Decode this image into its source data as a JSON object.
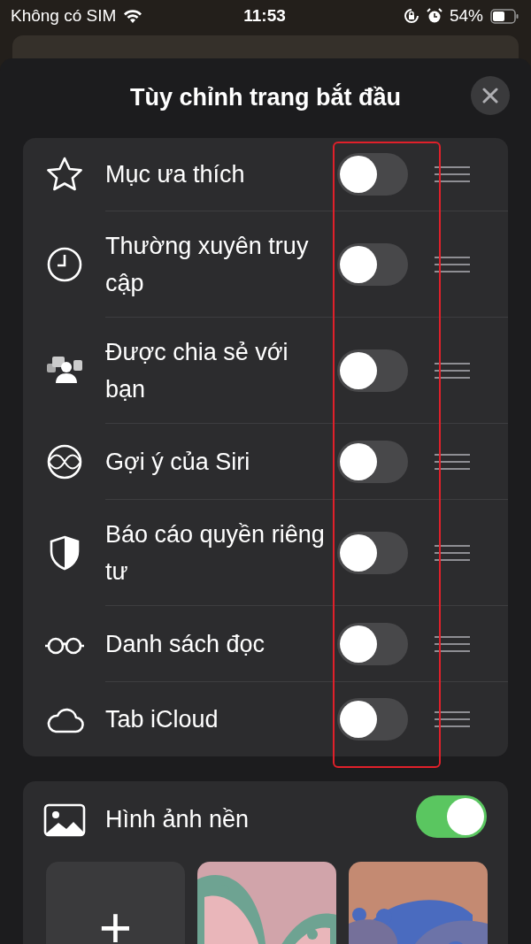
{
  "status_bar": {
    "carrier": "Không có SIM",
    "time": "11:53",
    "battery": "54%"
  },
  "title": "Tùy chỉnh trang bắt đầu",
  "sections": [
    {
      "label": "Mục ưa thích",
      "on": false
    },
    {
      "label": "Thường xuyên truy cập",
      "on": false
    },
    {
      "label": "Được chia sẻ với bạn",
      "on": false
    },
    {
      "label": "Gợi ý của Siri",
      "on": false
    },
    {
      "label": "Báo cáo quyền riêng tư",
      "on": false
    },
    {
      "label": "Danh sách đọc",
      "on": false
    },
    {
      "label": "Tab iCloud",
      "on": false
    }
  ],
  "wallpaper": {
    "label": "Hình ảnh nền",
    "on": true,
    "thumbnails": [
      {
        "kind": "add",
        "label": "+"
      },
      {
        "kind": "picture"
      },
      {
        "kind": "picture"
      }
    ]
  }
}
